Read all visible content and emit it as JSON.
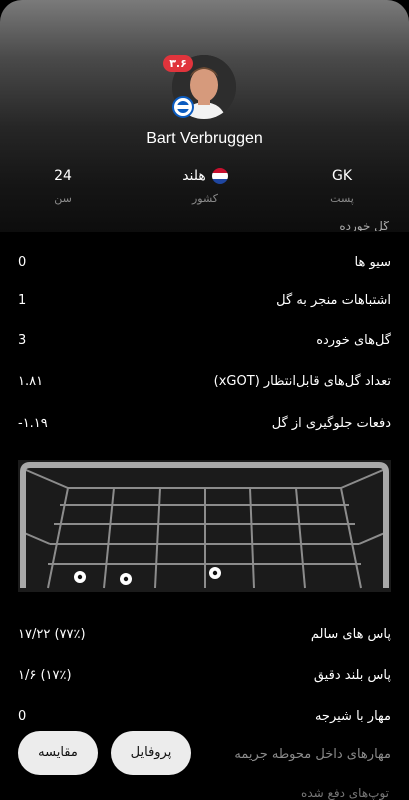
{
  "player": {
    "name": "Bart Verbruggen",
    "rating": "۳.۶",
    "club_icon": "brighton-crest-icon"
  },
  "info": {
    "age": {
      "value": "24",
      "label": "سن"
    },
    "country": {
      "value": "هلند",
      "label": "کشور",
      "flag_icon": "netherlands-flag-icon"
    },
    "position": {
      "value": "GK",
      "label": "پست"
    }
  },
  "partial_top_text": "گل خورده",
  "stats": [
    {
      "label": "سیو ها",
      "value": "0"
    },
    {
      "label": "اشتباهات منجر به گل",
      "value": "1"
    },
    {
      "label": "گل‌های خورده",
      "value": "3"
    },
    {
      "label": "تعداد گل‌های قابل‌انتظار (xGOT)",
      "value": "۱.۸۱"
    },
    {
      "label": "دفعات جلوگیری از گل",
      "value": "-۱.۱۹"
    }
  ],
  "goal_shots": 3,
  "stats2": [
    {
      "label": "پاس های سالم",
      "value": "۱۷/۲۲ (۷۷٪)"
    },
    {
      "label": "پاس بلند دقیق",
      "value": "۱/۶ (۱۷٪)"
    },
    {
      "label": "مهار با شیرجه",
      "value": "0"
    },
    {
      "label": "مهارهای داخل محوطه جریمه",
      "value": ""
    }
  ],
  "partial_bottom_text": "توپ‌های دفع شده",
  "buttons": {
    "compare": "مقایسه",
    "profile": "پروفایل"
  },
  "colors": {
    "badge": "#e0343c",
    "club": "#0b5bbf",
    "goal_frame": "#9a9a9a"
  }
}
